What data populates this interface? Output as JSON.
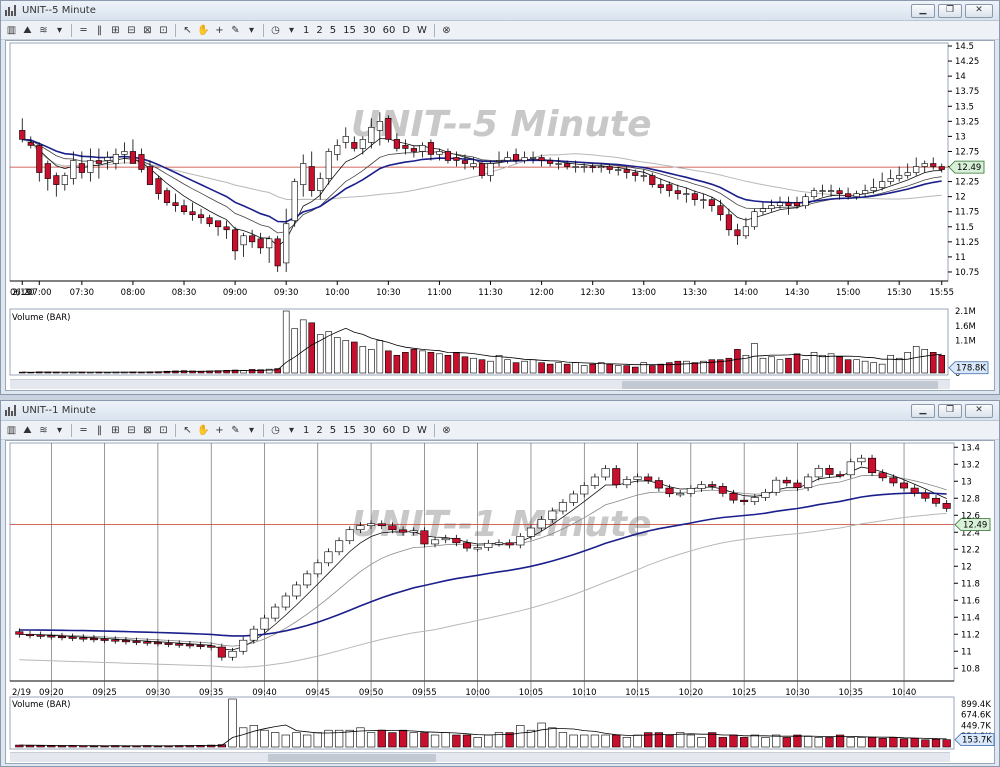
{
  "colors": {
    "up_fill": "#ffffff",
    "down_fill": "#c8102e",
    "ma_blue": "#1a1f8c",
    "ma_black": "#111111",
    "ma_gray": "#b8b8b8",
    "price_line": "#c0392b",
    "marker_fill": "#d8f0d8"
  },
  "toolbar": {
    "icons": [
      "chart-type-icon",
      "mountain-icon",
      "overlay-icon",
      "dropdown-icon",
      "hlines-icon",
      "vlines-icon",
      "zoom-in-icon",
      "zoom-fit-icon",
      "zoom-out-icon",
      "zoom-reset-icon",
      "pointer-icon",
      "hand-icon",
      "crosshair-icon",
      "pencil-icon",
      "dropdown-icon",
      "clock-icon",
      "dropdown-icon"
    ],
    "intervals": [
      "1",
      "2",
      "5",
      "15",
      "30",
      "60",
      "D",
      "W"
    ],
    "close_icon": "circle-x-icon"
  },
  "windows": [
    {
      "title": "UNIT--5 Minute",
      "watermark": "UNIT--5 Minute",
      "price_marker": "12.49",
      "volume_marker": "178.8K",
      "volume_label": "Volume (BAR)",
      "date_label": "2/19",
      "price_ticks": [
        "14.5",
        "14.25",
        "14",
        "13.75",
        "13.5",
        "13.25",
        "13",
        "12.75",
        "12.5",
        "12.25",
        "12",
        "11.75",
        "11.5",
        "11.25",
        "11",
        "10.75"
      ],
      "time_ticks": [
        "06:20",
        "07:00",
        "07:30",
        "08:00",
        "08:30",
        "09:00",
        "09:30",
        "10:00",
        "10:30",
        "11:00",
        "11:30",
        "12:00",
        "12:30",
        "13:00",
        "13:30",
        "14:00",
        "14:30",
        "15:00",
        "15:30",
        "15:55"
      ],
      "volume_ticks": [
        "2.1M",
        "1.6M",
        "1.1M",
        "0"
      ]
    },
    {
      "title": "UNIT--1 Minute",
      "watermark": "UNIT--1 Minute",
      "price_marker": "12.49",
      "volume_marker": "153.7K",
      "volume_label": "Volume (BAR)",
      "date_label": "2/19",
      "price_ticks": [
        "13.4",
        "13.2",
        "13",
        "12.8",
        "12.6",
        "12.4",
        "12.2",
        "12",
        "11.8",
        "11.6",
        "11.4",
        "11.2",
        "11",
        "10.8"
      ],
      "time_ticks": [
        "09:20",
        "09:25",
        "09:30",
        "09:35",
        "09:40",
        "09:45",
        "09:50",
        "09:55",
        "10:00",
        "10:05",
        "10:10",
        "10:15",
        "10:20",
        "10:25",
        "10:30",
        "10:35",
        "10:40"
      ],
      "volume_ticks": [
        "899.4K",
        "674.6K",
        "449.7K",
        "224.9K"
      ]
    }
  ],
  "chart_data": [
    {
      "type": "candlestick",
      "title": "UNIT--5 Minute",
      "ylim": [
        10.6,
        14.55
      ],
      "volume_ylim": [
        0,
        2100000
      ],
      "reference_price": 12.49,
      "x": [
        "06:20",
        "06:40",
        "07:00",
        "07:05",
        "07:10",
        "07:15",
        "07:20",
        "07:30",
        "07:35",
        "07:40",
        "07:45",
        "07:50",
        "07:55",
        "08:00",
        "08:05",
        "08:10",
        "08:15",
        "08:20",
        "08:25",
        "08:30",
        "08:35",
        "08:40",
        "08:45",
        "08:50",
        "08:55",
        "09:00",
        "09:05",
        "09:10",
        "09:15",
        "09:20",
        "09:25",
        "09:30",
        "09:35",
        "09:40",
        "09:45",
        "09:50",
        "09:55",
        "10:00",
        "10:05",
        "10:10",
        "10:15",
        "10:20",
        "10:25",
        "10:30",
        "10:35",
        "10:40",
        "10:45",
        "10:50",
        "10:55",
        "11:00",
        "11:05",
        "11:10",
        "11:15",
        "11:20",
        "11:25",
        "11:30",
        "11:35",
        "11:40",
        "11:45",
        "11:50",
        "11:55",
        "12:00",
        "12:05",
        "12:10",
        "12:15",
        "12:20",
        "12:25",
        "12:30",
        "12:35",
        "12:40",
        "12:45",
        "12:50",
        "12:55",
        "13:00",
        "13:05",
        "13:10",
        "13:15",
        "13:20",
        "13:25",
        "13:30",
        "13:35",
        "13:40",
        "13:45",
        "13:50",
        "13:55",
        "14:00",
        "14:05",
        "14:10",
        "14:15",
        "14:20",
        "14:25",
        "14:30",
        "14:35",
        "14:40",
        "14:45",
        "14:50",
        "14:55",
        "15:00",
        "15:05",
        "15:10",
        "15:15",
        "15:20",
        "15:25",
        "15:30",
        "15:35",
        "15:40",
        "15:45",
        "15:50",
        "15:55"
      ],
      "open": [
        13.1,
        12.9,
        12.85,
        12.55,
        12.35,
        12.2,
        12.3,
        12.55,
        12.4,
        12.6,
        12.6,
        12.55,
        12.7,
        12.75,
        12.7,
        12.5,
        12.3,
        12.1,
        11.9,
        11.85,
        11.75,
        11.7,
        11.65,
        11.6,
        11.5,
        11.45,
        11.2,
        11.35,
        11.3,
        11.15,
        11.3,
        10.9,
        11.6,
        12.2,
        12.5,
        12.1,
        12.3,
        12.7,
        12.9,
        12.9,
        12.8,
        12.9,
        13.1,
        13.3,
        12.95,
        12.85,
        12.8,
        12.75,
        12.9,
        12.7,
        12.75,
        12.65,
        12.6,
        12.5,
        12.55,
        12.35,
        12.6,
        12.6,
        12.7,
        12.6,
        12.65,
        12.65,
        12.6,
        12.55,
        12.55,
        12.5,
        12.5,
        12.5,
        12.48,
        12.5,
        12.45,
        12.45,
        12.4,
        12.35,
        12.35,
        12.2,
        12.2,
        12.1,
        12.05,
        12.05,
        11.95,
        11.95,
        11.85,
        11.7,
        11.45,
        11.35,
        11.5,
        11.75,
        11.8,
        11.85,
        11.9,
        11.9,
        11.85,
        12.0,
        12.1,
        12.1,
        12.1,
        12.05,
        12.0,
        12.05,
        12.1,
        12.15,
        12.25,
        12.3,
        12.35,
        12.4,
        12.5,
        12.55,
        12.5
      ],
      "high": [
        13.3,
        13.0,
        12.9,
        12.6,
        12.4,
        12.4,
        12.75,
        12.75,
        12.8,
        12.8,
        12.75,
        12.8,
        12.9,
        12.95,
        12.8,
        12.6,
        12.35,
        12.15,
        12.05,
        11.95,
        11.9,
        11.8,
        11.7,
        11.6,
        11.6,
        11.5,
        11.4,
        11.45,
        11.4,
        11.35,
        11.35,
        11.8,
        12.3,
        12.7,
        12.75,
        12.4,
        12.8,
        12.95,
        13.15,
        13.0,
        13.0,
        13.3,
        13.4,
        13.35,
        13.05,
        12.95,
        12.85,
        12.9,
        12.95,
        12.8,
        12.8,
        12.75,
        12.7,
        12.65,
        12.6,
        12.6,
        12.75,
        12.75,
        12.8,
        12.75,
        12.75,
        12.7,
        12.65,
        12.65,
        12.6,
        12.6,
        12.55,
        12.55,
        12.55,
        12.55,
        12.5,
        12.5,
        12.45,
        12.45,
        12.4,
        12.3,
        12.25,
        12.2,
        12.15,
        12.1,
        12.05,
        12.0,
        11.95,
        11.8,
        11.55,
        11.65,
        11.8,
        11.9,
        11.95,
        12.0,
        12.0,
        12.0,
        12.05,
        12.15,
        12.2,
        12.2,
        12.15,
        12.15,
        12.1,
        12.2,
        12.3,
        12.4,
        12.45,
        12.5,
        12.55,
        12.65,
        12.6,
        12.65,
        12.55
      ],
      "low": [
        12.9,
        12.8,
        12.25,
        12.1,
        12.0,
        12.1,
        12.2,
        12.3,
        12.25,
        12.3,
        12.45,
        12.45,
        12.55,
        12.55,
        12.4,
        12.2,
        11.95,
        11.85,
        11.75,
        11.7,
        11.6,
        11.55,
        11.5,
        11.35,
        11.3,
        10.95,
        11.0,
        11.15,
        11.05,
        10.9,
        10.75,
        10.75,
        11.5,
        12.0,
        12.0,
        11.95,
        12.2,
        12.6,
        12.8,
        12.75,
        12.7,
        12.8,
        12.85,
        12.9,
        12.75,
        12.7,
        12.65,
        12.65,
        12.6,
        12.6,
        12.55,
        12.5,
        12.45,
        12.45,
        12.3,
        12.25,
        12.5,
        12.55,
        12.55,
        12.55,
        12.55,
        12.5,
        12.5,
        12.45,
        12.45,
        12.4,
        12.4,
        12.4,
        12.4,
        12.38,
        12.35,
        12.3,
        12.25,
        12.25,
        12.15,
        12.05,
        12.0,
        11.95,
        11.9,
        11.85,
        11.8,
        11.75,
        11.6,
        11.35,
        11.2,
        11.3,
        11.45,
        11.7,
        11.75,
        11.8,
        11.7,
        11.8,
        11.8,
        11.95,
        12.0,
        12.0,
        11.95,
        11.95,
        11.95,
        12.0,
        12.05,
        12.1,
        12.2,
        12.25,
        12.3,
        12.35,
        12.4,
        12.45,
        12.4
      ],
      "close": [
        12.95,
        12.85,
        12.4,
        12.3,
        12.2,
        12.35,
        12.6,
        12.4,
        12.6,
        12.55,
        12.65,
        12.7,
        12.75,
        12.55,
        12.45,
        12.2,
        12.05,
        11.9,
        11.85,
        11.75,
        11.7,
        11.65,
        11.55,
        11.5,
        11.45,
        11.1,
        11.35,
        11.25,
        11.15,
        11.3,
        10.85,
        11.55,
        12.25,
        12.55,
        12.1,
        12.3,
        12.75,
        12.85,
        13.0,
        12.8,
        12.95,
        13.15,
        13.25,
        12.95,
        12.8,
        12.8,
        12.75,
        12.85,
        12.7,
        12.75,
        12.6,
        12.6,
        12.55,
        12.55,
        12.35,
        12.55,
        12.6,
        12.65,
        12.6,
        12.65,
        12.65,
        12.6,
        12.55,
        12.55,
        12.5,
        12.5,
        12.5,
        12.48,
        12.5,
        12.45,
        12.45,
        12.4,
        12.35,
        12.35,
        12.2,
        12.15,
        12.1,
        12.05,
        12.05,
        11.95,
        11.95,
        11.85,
        11.7,
        11.45,
        11.35,
        11.5,
        11.75,
        11.8,
        11.85,
        11.9,
        11.85,
        11.85,
        12.0,
        12.1,
        12.1,
        12.1,
        12.05,
        12.0,
        12.05,
        12.1,
        12.15,
        12.25,
        12.3,
        12.35,
        12.4,
        12.5,
        12.55,
        12.5,
        12.45
      ],
      "volume": [
        30000,
        20000,
        40000,
        35000,
        30000,
        25000,
        30000,
        30000,
        25000,
        30000,
        25000,
        30000,
        30000,
        35000,
        30000,
        40000,
        45000,
        60000,
        70000,
        80000,
        70000,
        60000,
        70000,
        80000,
        90000,
        100000,
        90000,
        120000,
        110000,
        130000,
        150000,
        2100000,
        1500000,
        1800000,
        1700000,
        1300000,
        1400000,
        1200000,
        1100000,
        1050000,
        900000,
        800000,
        1100000,
        750000,
        600000,
        700000,
        800000,
        750000,
        700000,
        650000,
        600000,
        700000,
        550000,
        500000,
        450000,
        400000,
        600000,
        450000,
        350000,
        400000,
        450000,
        350000,
        300000,
        350000,
        300000,
        350000,
        250000,
        300000,
        350000,
        300000,
        250000,
        250000,
        200000,
        350000,
        250000,
        300000,
        350000,
        400000,
        400000,
        350000,
        400000,
        450000,
        450000,
        500000,
        800000,
        600000,
        1000000,
        500000,
        550000,
        450000,
        500000,
        650000,
        450000,
        700000,
        600000,
        650000,
        550000,
        450000,
        450000,
        400000,
        350000,
        300000,
        600000,
        500000,
        700000,
        900000,
        800000,
        700000,
        600000
      ]
    },
    {
      "type": "candlestick",
      "title": "UNIT--1 Minute",
      "ylim": [
        10.65,
        13.45
      ],
      "volume_ylim": [
        0,
        1000000
      ],
      "reference_price": 12.49,
      "x_range": [
        "09:17",
        "10:45"
      ],
      "volume": [
        40000,
        35000,
        30000,
        30000,
        25000,
        30000,
        25000,
        20000,
        25000,
        30000,
        20000,
        25000,
        30000,
        20000,
        25000,
        30000,
        30000,
        35000,
        40000,
        50000,
        1000000,
        400000,
        450000,
        350000,
        300000,
        250000,
        300000,
        250000,
        300000,
        350000,
        350000,
        350000,
        400000,
        300000,
        350000,
        300000,
        350000,
        300000,
        300000,
        250000,
        300000,
        250000,
        250000,
        200000,
        250000,
        300000,
        300000,
        450000,
        350000,
        500000,
        400000,
        300000,
        250000,
        250000,
        250000,
        250000,
        250000,
        200000,
        250000,
        300000,
        300000,
        250000,
        300000,
        250000,
        200000,
        300000,
        200000,
        250000,
        200000,
        250000,
        200000,
        250000,
        200000,
        250000,
        220000,
        200000,
        200000,
        250000,
        200000,
        200000,
        200000,
        180000,
        200000,
        170000,
        180000,
        150000,
        160000,
        153700
      ]
    }
  ]
}
